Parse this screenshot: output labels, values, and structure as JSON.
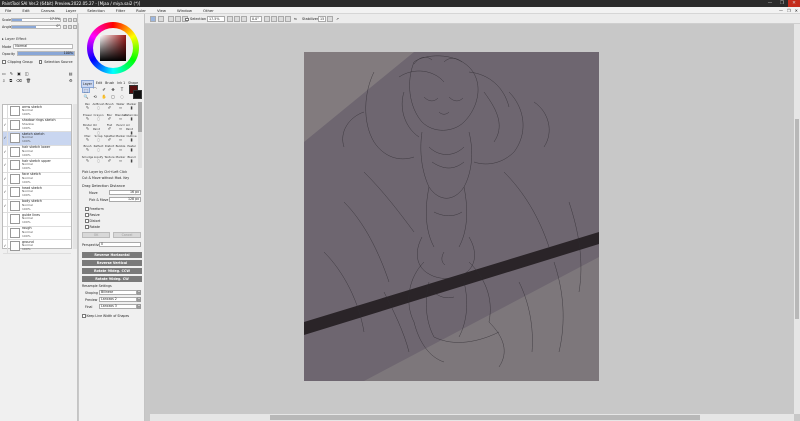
{
  "window": {
    "title": "PaintTool SAI Ver.2 (64bit) Preview.2022.05.27 - [Mjaa / miya.sai2 (*)]",
    "min": "—",
    "max": "❐",
    "close": "✕"
  },
  "menu": [
    "File",
    "Edit",
    "Canvas",
    "Layer",
    "Selection",
    "Filter",
    "Ruler",
    "View",
    "Window",
    "Other"
  ],
  "menu_right": [
    "—",
    "❐",
    "✕"
  ],
  "toolbar": {
    "selection_label": "Selection",
    "zoom_value": "17.5%",
    "angle_value": "0.0°",
    "stabilizer_label": "Stabilizer",
    "stabilizer_value": "15"
  },
  "left_panel": {
    "size_label": "Scale",
    "size_value": "17.5%",
    "angle_label": "Angle",
    "angle_value": "0°",
    "size_fraction": 0.2,
    "angle_fraction": 0.5,
    "layer_effect_header": "Layer Effect",
    "mode_label": "Mode",
    "mode_value": "Normal",
    "opacity_label": "Opacity",
    "opacity_value": "100%",
    "opacity_fraction": 1.0,
    "clipping_label": "Clipping Group",
    "selection_source_label": "Selection Source"
  },
  "layers": [
    {
      "name": "arms sketch",
      "mode": "Normal",
      "opacity": "100%",
      "visible": "",
      "selected": false
    },
    {
      "name": "shadow rings sketch",
      "mode": "Shadow",
      "opacity": "100%",
      "visible": "✓",
      "selected": false
    },
    {
      "name": "sketch sketch",
      "mode": "Normal",
      "opacity": "100%",
      "visible": "✓",
      "selected": true
    },
    {
      "name": "hair sketch lower",
      "mode": "Normal",
      "opacity": "100%",
      "visible": "✓",
      "selected": false
    },
    {
      "name": "hair sketch upper",
      "mode": "Normal",
      "opacity": "100%",
      "visible": "✓",
      "selected": false
    },
    {
      "name": "face sketch",
      "mode": "Normal",
      "opacity": "100%",
      "visible": "✓",
      "selected": false
    },
    {
      "name": "head sketch",
      "mode": "Normal",
      "opacity": "100%",
      "visible": "✓",
      "selected": false
    },
    {
      "name": "body sketch",
      "mode": "Normal",
      "opacity": "100%",
      "visible": "✓",
      "selected": false
    },
    {
      "name": "guide lines",
      "mode": "Normal",
      "opacity": "100%",
      "visible": "",
      "selected": false
    },
    {
      "name": "rough",
      "mode": "Normal",
      "opacity": "100%",
      "visible": "",
      "selected": false
    },
    {
      "name": "ground",
      "mode": "Normal",
      "opacity": "100%",
      "visible": "✓",
      "selected": false
    }
  ],
  "tool_panel": {
    "tabs": [
      "Layer",
      "Edit",
      "Brush",
      "Ink 1",
      "Shape"
    ],
    "fg_color": "#5a1010",
    "bg_color": "#111111",
    "quick_tools": [
      "⬚",
      "⌒",
      "✐",
      "✥",
      "T",
      "🔍",
      "⟲",
      "✋",
      "▢",
      "◌"
    ],
    "brushes": [
      [
        "Pen",
        "AirBrush",
        "Brush",
        "Water",
        "Marker"
      ],
      [
        "Eraser",
        "Crayon",
        "Blur",
        "Blender",
        "Watercolor"
      ],
      [
        "Binder",
        "Oil Paint",
        "Flat",
        "Pencil",
        "Air Paint"
      ],
      [
        "Misc",
        "Scrap",
        "Splatter",
        "Marker",
        "Outline"
      ],
      [
        "Brush",
        "Reflect",
        "Distort",
        "Bubble",
        "Pastel"
      ],
      [
        "Smudge",
        "Liquify",
        "Texture",
        "Marker",
        "Blend"
      ]
    ],
    "pick_layer_label": "Pick Layer by Ctrl+Left Click",
    "cut_move_label": "Cut & Move without Mod. Key",
    "drag_header": "Drag Detection Distance",
    "move_label": "Move",
    "move_value": "16 px",
    "pick_move_label": "Pick & Move",
    "pick_move_value": "128 px",
    "transform_label": "Freeform",
    "resize_label": "Resize",
    "distort_label": "Distort",
    "rotate_label": "Rotate",
    "ok_label": "OK",
    "cancel_label": "Cancel",
    "perspective_label": "Perspective",
    "perspective_value": "0",
    "reverse_h": "Reverse Horizontal",
    "reverse_v": "Reverse Vertical",
    "rotate_ccw": "Rotate 90deg. CCW",
    "rotate_cw": "Rotate 90deg. CW",
    "resample_header": "Resample Settings",
    "shaping_label": "Shaping",
    "shaping_value": "Bilinear",
    "preview_label": "Preview",
    "preview_value": "Lanczos 2",
    "final_label": "Final",
    "final_value": "Lanczos 3",
    "keep_line_label": "Keep Line Width of Shapes"
  },
  "canvas": {
    "background": "#6e6670",
    "band_color": "#8a8585"
  }
}
